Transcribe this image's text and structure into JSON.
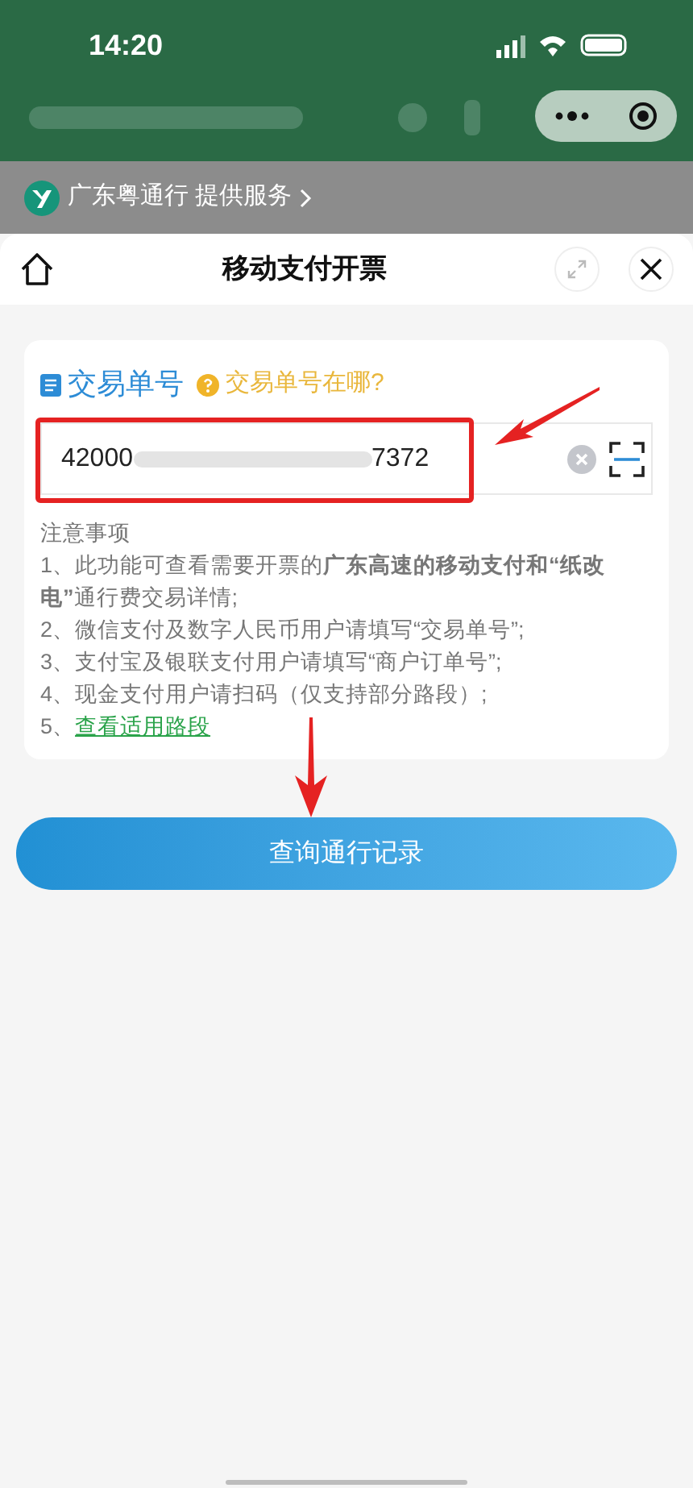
{
  "status_bar": {
    "time": "14:20"
  },
  "provider": {
    "text": "广东粤通行 提供服务"
  },
  "sheet": {
    "title": "移动支付开票"
  },
  "form": {
    "label": "交易单号",
    "help_link": "交易单号在哪?",
    "value_start": "42000",
    "value_end": "7372"
  },
  "notes": {
    "title": "注意事项",
    "items": [
      {
        "kind": "text",
        "text": "1、此功能可查看需要开票的**广东高速的移动支付和“纸改电”**通行费交易详情;"
      },
      {
        "kind": "text",
        "text": "2、微信支付及数字人民币用户请填写“交易单号”;"
      },
      {
        "kind": "text",
        "text": "3、支付宝及银联支付用户请填写“商户订单号”;"
      },
      {
        "kind": "text",
        "text": "4、现金支付用户请扫码（仅支持部分路段）;"
      },
      {
        "kind": "link",
        "prefix": "5、",
        "link": "查看适用路段"
      }
    ]
  },
  "submit_button": "查询通行记录"
}
